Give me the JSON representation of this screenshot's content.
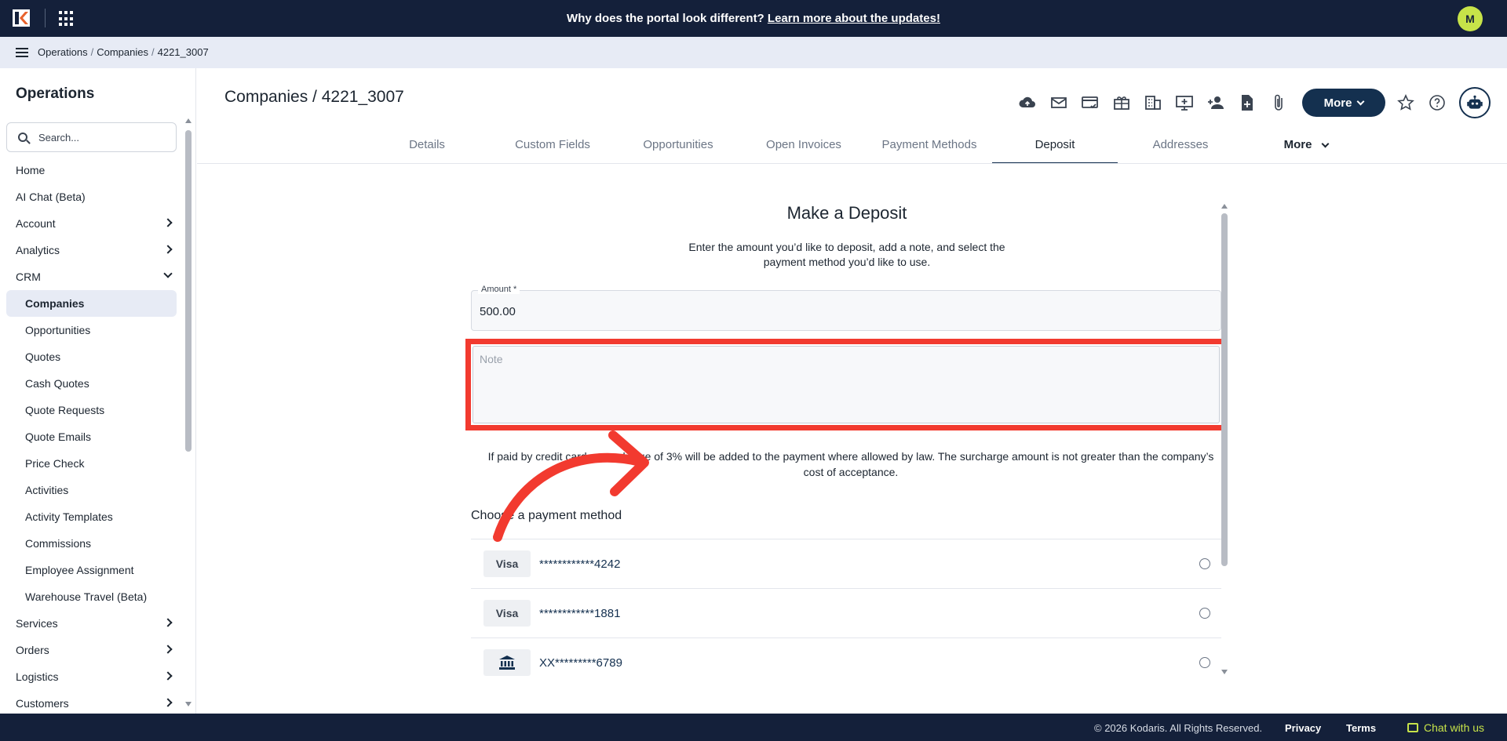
{
  "banner": {
    "text": "Why does the portal look different?",
    "link": "Learn more about the updates!"
  },
  "user": {
    "initial": "M"
  },
  "breadcrumb": {
    "items": [
      "Operations",
      "Companies",
      "4221_3007"
    ],
    "separator": "/"
  },
  "sidebar": {
    "title": "Operations",
    "search_placeholder": "Search...",
    "items": [
      {
        "label": "Home"
      },
      {
        "label": "AI Chat (Beta)"
      },
      {
        "label": "Account"
      },
      {
        "label": "Analytics"
      },
      {
        "label": "CRM"
      },
      {
        "label": "Services"
      },
      {
        "label": "Orders"
      },
      {
        "label": "Logistics"
      },
      {
        "label": "Customers"
      }
    ],
    "crm_children": [
      "Companies",
      "Opportunities",
      "Quotes",
      "Cash Quotes",
      "Quote Requests",
      "Quote Emails",
      "Price Check",
      "Activities",
      "Activity Templates",
      "Commissions",
      "Employee Assignment",
      "Warehouse Travel (Beta)"
    ]
  },
  "page": {
    "title": "Companies / 4221_3007"
  },
  "toolbar": {
    "more_label": "More",
    "icons": [
      "cloud-upload-icon",
      "mail-icon",
      "card-check-icon",
      "gift-icon",
      "building-icon",
      "monitor-add-icon",
      "person-add-icon",
      "file-add-icon",
      "paperclip-icon",
      "star-icon",
      "help-icon",
      "robot-icon"
    ]
  },
  "tabs": {
    "items": [
      "Details",
      "Custom Fields",
      "Opportunities",
      "Open Invoices",
      "Payment Methods",
      "Deposit",
      "Addresses"
    ],
    "active": "Deposit",
    "more_label": "More"
  },
  "deposit": {
    "title": "Make a Deposit",
    "description": "Enter the amount you’d like to deposit, add a note, and select the payment method you’d like to use.",
    "amount_label": "Amount *",
    "amount_value": "500.00",
    "note_placeholder": "Note",
    "surcharge": "If paid by credit card, a surcharge of 3% will be added to the payment where allowed by law. The surcharge amount is not greater than the company’s cost of acceptance.",
    "payment_title": "Choose a payment method",
    "payment_methods": [
      {
        "type": "Visa",
        "number": "************4242"
      },
      {
        "type": "Visa",
        "number": "************1881"
      },
      {
        "type": "bank-icon",
        "number": "XX*********6789"
      }
    ]
  },
  "footer": {
    "copyright": "© 2026 Kodaris. All Rights Reserved.",
    "privacy": "Privacy",
    "terms": "Terms",
    "chat": "Chat with us"
  },
  "colors": {
    "navy": "#14203a",
    "accent": "#c7e349",
    "highlight": "#f23a2f"
  }
}
